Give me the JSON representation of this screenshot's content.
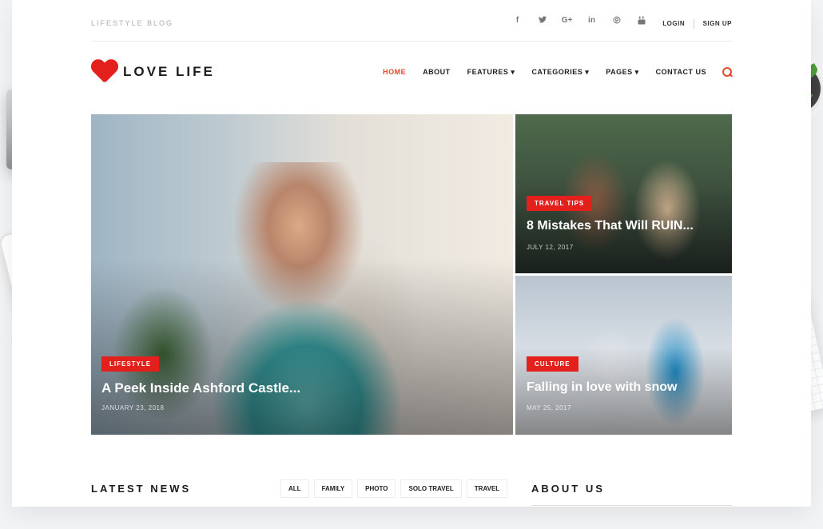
{
  "topbar": {
    "blog_label": "LIFESTYLE BLOG",
    "socials": [
      "f",
      "t",
      "G+",
      "in",
      "p",
      "yt"
    ],
    "login": "LOGIN",
    "signup": "SIGN UP"
  },
  "brand": {
    "name": "LOVE LIFE",
    "accent": "#e3201b"
  },
  "nav": {
    "items": [
      {
        "label": "HOME",
        "active": true
      },
      {
        "label": "ABOUT"
      },
      {
        "label": "FEATURES ▾"
      },
      {
        "label": "CATEGORIES ▾"
      },
      {
        "label": "PAGES ▾"
      },
      {
        "label": "CONTACT US"
      }
    ],
    "search_icon": "search-icon"
  },
  "hero": {
    "main": {
      "category": "LIFESTYLE",
      "title": "A Peek Inside Ashford Castle...",
      "date": "JANUARY 23, 2018"
    },
    "top_right": {
      "category": "TRAVEL TIPS",
      "title": "8 Mistakes That Will RUIN...",
      "date": "JULY 12, 2017"
    },
    "bottom_right": {
      "category": "CULTURE",
      "title": "Falling in love with snow",
      "date": "MAY 25, 2017"
    }
  },
  "latest_news": {
    "title": "LATEST NEWS",
    "filters": [
      "ALL",
      "FAMILY",
      "PHOTO",
      "SOLO TRAVEL",
      "TRAVEL"
    ]
  },
  "about_us": {
    "title": "ABOUT US"
  }
}
